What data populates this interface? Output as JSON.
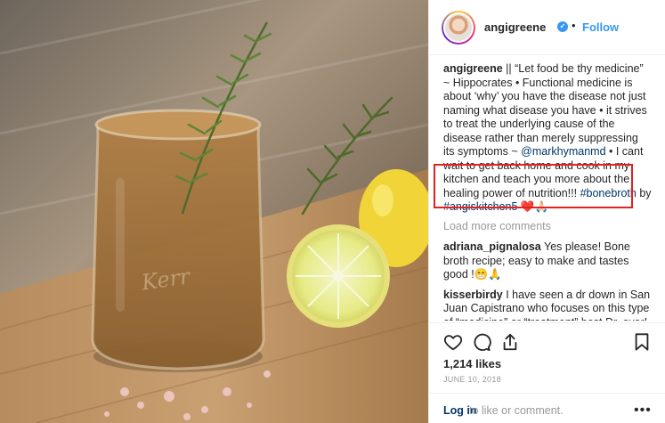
{
  "header": {
    "username": "angigreene",
    "verified_glyph": "✓",
    "separator": "•",
    "follow_label": "Follow"
  },
  "caption": {
    "username": "angigreene",
    "text_1": " || “Let food be thy medicine” ~ Hippocrates • Functional medicine is about ‘why’ you have the disease not just naming what disease you have • it strives to treat the underlying cause of the disease rather than merely suppressing its symptoms ~ ",
    "mention": "@markhymanmd",
    "text_2": " • I cant wait to get back home and cook in my kitchen and teach you more about the healing power of nutrition!!! ",
    "hashtag_1": "#bonebroth",
    "text_3": " by ",
    "hashtag_2": "#angiskitchen5",
    "emoji": " ❤️🙏🏻"
  },
  "load_more": "Load more comments",
  "comments": [
    {
      "username": "adriana_pignalosa",
      "text": " Yes please! Bone broth recipe; easy to make and tastes good !😁🙏"
    },
    {
      "username": "kisserbirdy",
      "text": " I have seen a dr down in San Juan Capistrano who focuses on this type of “medicine” or “treatment” best Dr. ever! He is always asking “why” instead of"
    }
  ],
  "likes": "1,214 likes",
  "date": "JUNE 10, 2018",
  "login": {
    "link": "Log in",
    "text": " to like or comment.",
    "more": "•••"
  },
  "icons": [
    "heart-icon",
    "comment-icon",
    "share-icon",
    "bookmark-icon",
    "verified-icon"
  ],
  "colors": {
    "accent": "#3897f0",
    "link": "#003569",
    "highlight": "#e5211d"
  }
}
